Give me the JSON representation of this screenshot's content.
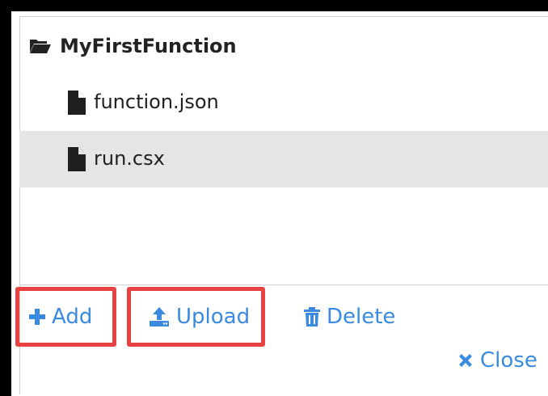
{
  "tree": {
    "folder": {
      "label": "MyFirstFunction",
      "icon": "folder-open-icon"
    },
    "files": [
      {
        "label": "function.json",
        "icon": "file-icon",
        "selected": false
      },
      {
        "label": "run.csx",
        "icon": "file-icon",
        "selected": true
      }
    ]
  },
  "toolbar": {
    "add_label": "Add",
    "upload_label": "Upload",
    "delete_label": "Delete",
    "close_label": "Close"
  },
  "colors": {
    "accent": "#3a8be0",
    "highlight": "#e8413f",
    "selected_row": "#e5e5e5"
  }
}
